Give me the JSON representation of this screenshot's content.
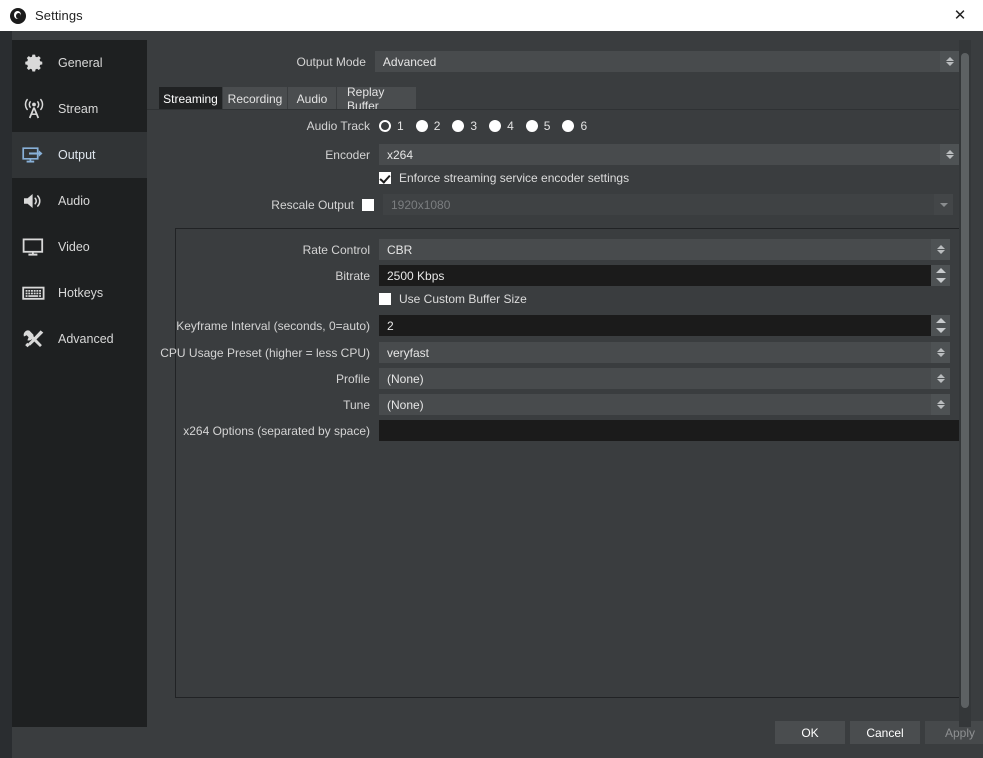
{
  "window": {
    "title": "Settings",
    "app_icon": "obs-logo-icon",
    "close_label": "✕"
  },
  "sidebar": {
    "items": [
      {
        "label": "General",
        "icon": "gear-icon",
        "selected": false
      },
      {
        "label": "Stream",
        "icon": "broadcast-icon",
        "selected": false
      },
      {
        "label": "Output",
        "icon": "monitor-arrow-icon",
        "selected": true
      },
      {
        "label": "Audio",
        "icon": "speaker-icon",
        "selected": false
      },
      {
        "label": "Video",
        "icon": "monitor-icon",
        "selected": false
      },
      {
        "label": "Hotkeys",
        "icon": "keyboard-icon",
        "selected": false
      },
      {
        "label": "Advanced",
        "icon": "tools-icon",
        "selected": false
      }
    ]
  },
  "output_mode": {
    "label": "Output Mode",
    "value": "Advanced"
  },
  "tabs": [
    {
      "label": "Streaming",
      "active": true
    },
    {
      "label": "Recording",
      "active": false
    },
    {
      "label": "Audio",
      "active": false
    },
    {
      "label": "Replay Buffer",
      "active": false
    }
  ],
  "streaming": {
    "audio_track": {
      "label": "Audio Track",
      "options": [
        "1",
        "2",
        "3",
        "4",
        "5",
        "6"
      ],
      "selected": "1"
    },
    "encoder": {
      "label": "Encoder",
      "value": "x264"
    },
    "enforce": {
      "label": "Enforce streaming service encoder settings",
      "checked": true
    },
    "rescale_output": {
      "label": "Rescale Output",
      "checked": false,
      "value": "1920x1080",
      "disabled": true
    },
    "rate_control": {
      "label": "Rate Control",
      "value": "CBR"
    },
    "bitrate": {
      "label": "Bitrate",
      "value": "2500 Kbps"
    },
    "custom_buffer": {
      "label": "Use Custom Buffer Size",
      "checked": false
    },
    "keyframe_interval": {
      "label": "Keyframe Interval (seconds, 0=auto)",
      "value": "2"
    },
    "cpu_preset": {
      "label": "CPU Usage Preset (higher = less CPU)",
      "value": "veryfast"
    },
    "profile": {
      "label": "Profile",
      "value": "(None)"
    },
    "tune": {
      "label": "Tune",
      "value": "(None)"
    },
    "x264_options": {
      "label": "x264 Options (separated by space)",
      "value": "",
      "placeholder": ""
    }
  },
  "buttons": {
    "ok": "OK",
    "cancel": "Cancel",
    "apply": "Apply",
    "apply_disabled": true
  },
  "colors": {
    "accent_blue": "#8ab4d8",
    "panel_bg": "#3a3d3f",
    "sidebar_bg": "#1e2021",
    "input_bg": "#1b1b1b",
    "combo_bg": "#484b4d",
    "titlebar_bg": "#ffffff"
  }
}
